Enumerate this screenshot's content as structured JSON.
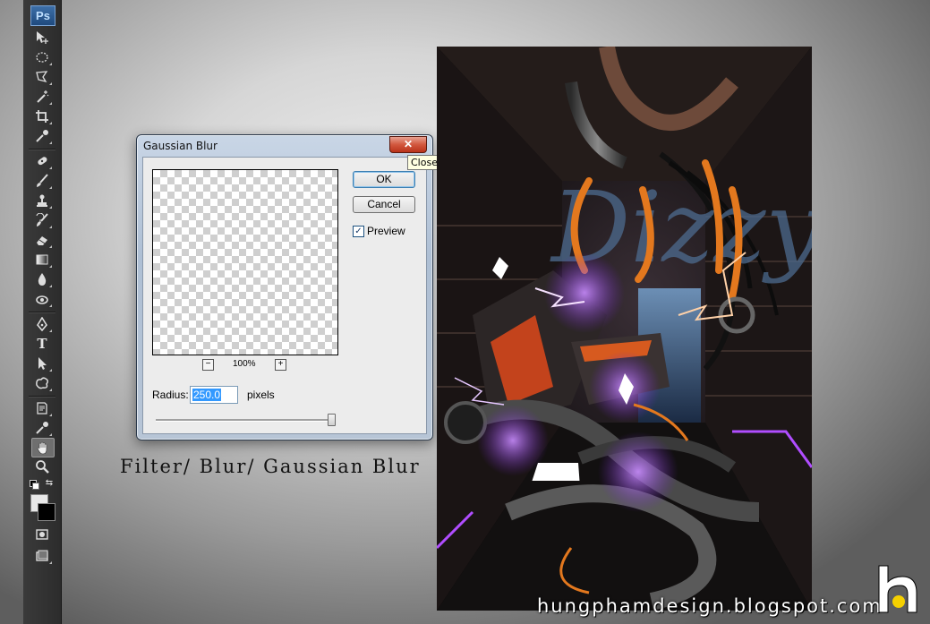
{
  "app": {
    "logo": "Ps"
  },
  "toolbar": {
    "tools": [
      {
        "name": "move-tool-icon"
      },
      {
        "name": "elliptical-marquee-tool-icon"
      },
      {
        "name": "polygonal-lasso-tool-icon"
      },
      {
        "name": "magic-wand-tool-icon"
      },
      {
        "name": "crop-tool-icon"
      },
      {
        "name": "eyedropper-tool-icon"
      },
      {
        "name": "spot-healing-brush-tool-icon"
      },
      {
        "name": "brush-tool-icon"
      },
      {
        "name": "clone-stamp-tool-icon"
      },
      {
        "name": "history-brush-tool-icon"
      },
      {
        "name": "eraser-tool-icon"
      },
      {
        "name": "gradient-tool-icon"
      },
      {
        "name": "blur-tool-icon"
      },
      {
        "name": "dodge-tool-icon"
      },
      {
        "name": "pen-tool-icon"
      },
      {
        "name": "type-tool-icon",
        "glyph": "T"
      },
      {
        "name": "path-selection-tool-icon"
      },
      {
        "name": "custom-shape-tool-icon"
      },
      {
        "name": "notes-tool-icon"
      },
      {
        "name": "eyedropper-3d-tool-icon"
      },
      {
        "name": "hand-tool-icon",
        "active": true
      },
      {
        "name": "zoom-tool-icon"
      }
    ],
    "colors": {
      "foreground": "#e8e8e8",
      "background": "#000000"
    }
  },
  "dialog": {
    "title": "Gaussian Blur",
    "close_label": "✕",
    "close_tooltip": "Close",
    "ok_label": "OK",
    "cancel_label": "Cancel",
    "preview_label": "Preview",
    "preview_checked": true,
    "zoom_level": "100%",
    "zoom_out_label": "−",
    "zoom_in_label": "+",
    "radius_label": "Radius:",
    "radius_value": "250.0",
    "radius_unit": "pixels"
  },
  "caption": "Filter/ Blur/ Gaussian Blur",
  "watermark": "hungphamdesign.blogspot.com",
  "artwork": {
    "lettering": "Dizzy"
  },
  "colors": {
    "accent_orange": "#e3781e",
    "accent_purple": "#a64bff",
    "logo_yellow": "#f5d000"
  }
}
